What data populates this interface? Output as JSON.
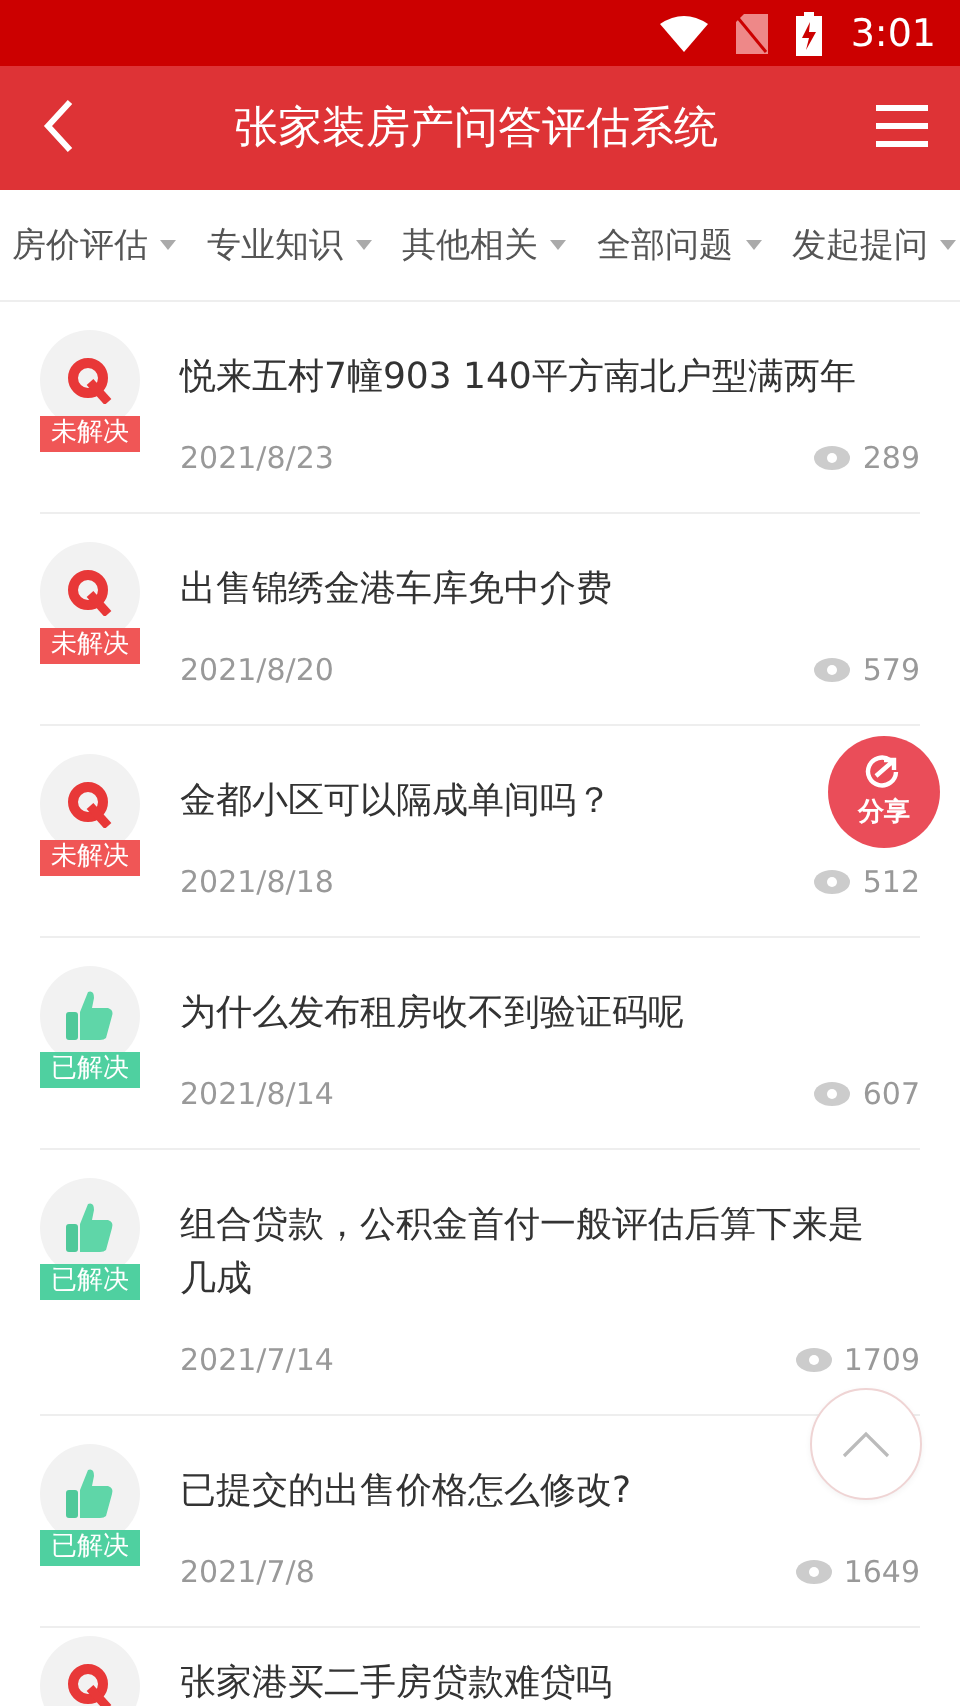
{
  "status_bar": {
    "time": "3:01"
  },
  "header": {
    "title": "张家装房产问答评估系统"
  },
  "filters": [
    {
      "label": "房价评估"
    },
    {
      "label": "专业知识"
    },
    {
      "label": "其他相关"
    },
    {
      "label": "全部问题"
    },
    {
      "label": "发起提问"
    }
  ],
  "questions": [
    {
      "kind": "unresolved",
      "badge": "未解决",
      "title": "悦来五村7幢903 140平方南北户型满两年",
      "date": "2021/8/23",
      "views": "289"
    },
    {
      "kind": "unresolved",
      "badge": "未解决",
      "title": "出售锦绣金港车库免中介费",
      "date": "2021/8/20",
      "views": "579"
    },
    {
      "kind": "unresolved",
      "badge": "未解决",
      "title": "金都小区可以隔成单间吗？",
      "date": "2021/8/18",
      "views": "512"
    },
    {
      "kind": "resolved",
      "badge": "已解决",
      "title": "为什么发布租房收不到验证码呢",
      "date": "2021/8/14",
      "views": "607"
    },
    {
      "kind": "resolved",
      "badge": "已解决",
      "title": "组合贷款，公积金首付一般评估后算下来是几成",
      "date": "2021/7/14",
      "views": "1709"
    },
    {
      "kind": "resolved",
      "badge": "已解决",
      "title": "已提交的出售价格怎么修改?",
      "date": "2021/7/8",
      "views": "1649"
    },
    {
      "kind": "unresolved",
      "title": "张家港买二手房贷款难贷吗"
    }
  ],
  "share_button": {
    "label": "分享"
  }
}
